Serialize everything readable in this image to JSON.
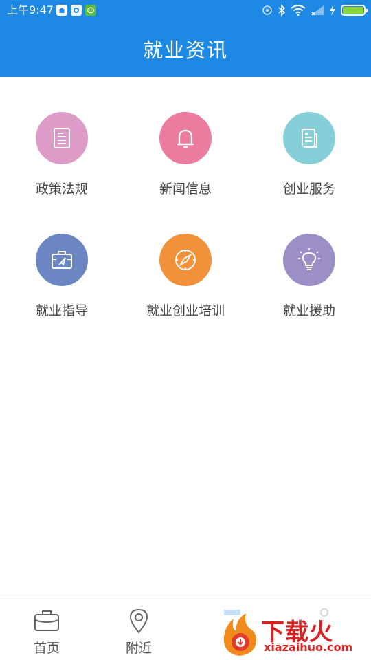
{
  "status_bar": {
    "time": "上午9:47",
    "apps": [
      "house-app-icon",
      "weather-app-icon",
      "wechat-app-icon"
    ],
    "battery_level": 1.0,
    "colors": {
      "background": "#1e88e5",
      "battery": "#8bd43a"
    }
  },
  "header": {
    "title": "就业资讯",
    "background": "#1e88e5"
  },
  "grid": {
    "items": [
      {
        "label": "政策法规",
        "icon": "document-icon",
        "color": "#dd9bc7"
      },
      {
        "label": "新闻信息",
        "icon": "bell-icon",
        "color": "#ec7c9d"
      },
      {
        "label": "创业服务",
        "icon": "files-icon",
        "color": "#86cfd9"
      },
      {
        "label": "就业指导",
        "icon": "briefcase-compass-icon",
        "color": "#6b86c2"
      },
      {
        "label": "就业创业培训",
        "icon": "compass-icon",
        "color": "#f1923a"
      },
      {
        "label": "就业援助",
        "icon": "lightbulb-icon",
        "color": "#9b8fc6"
      }
    ]
  },
  "bottom_nav": {
    "items": [
      {
        "label": "首页",
        "icon": "briefcase-icon"
      },
      {
        "label": "附近",
        "icon": "location-pin-icon"
      }
    ]
  },
  "watermark": {
    "brand_cn": "下载火",
    "brand_url": "xiazaihuo.com"
  }
}
